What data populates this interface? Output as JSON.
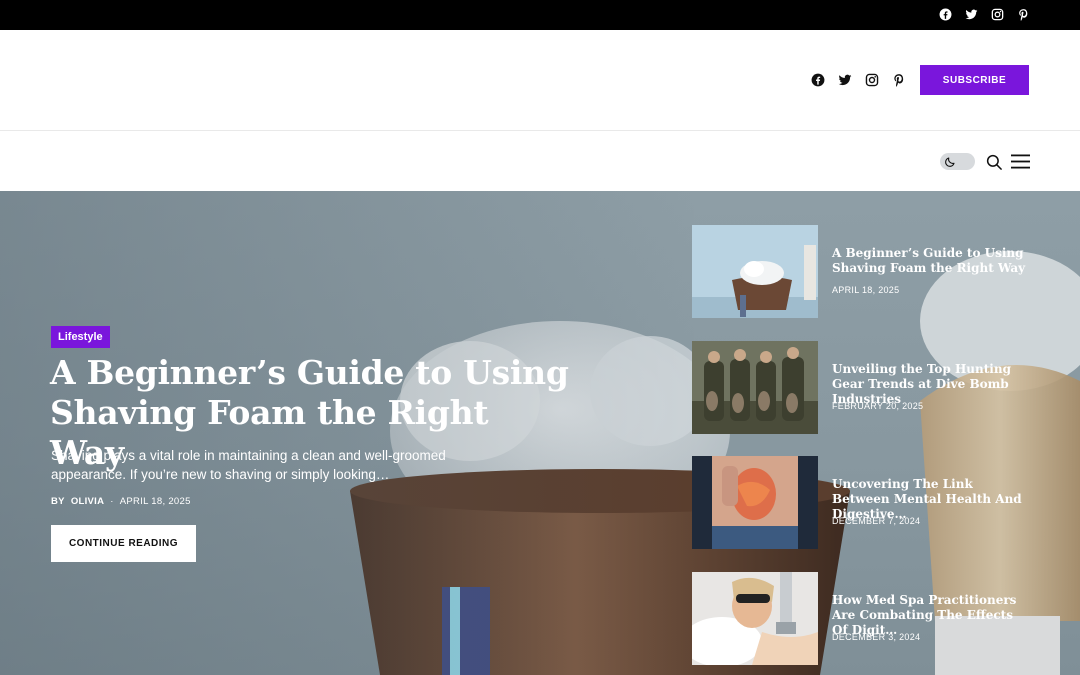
{
  "topbar": {
    "socials": [
      {
        "icon": "facebook-icon"
      },
      {
        "icon": "twitter-icon"
      },
      {
        "icon": "instagram-icon"
      },
      {
        "icon": "pinterest-icon"
      }
    ]
  },
  "header": {
    "socials": [
      {
        "icon": "facebook-icon"
      },
      {
        "icon": "twitter-icon"
      },
      {
        "icon": "instagram-icon"
      },
      {
        "icon": "pinterest-icon"
      }
    ],
    "subscribe_label": "SUBSCRIBE"
  },
  "navbar": {
    "toggle_icon": "moon-icon",
    "search_icon": "search-icon",
    "menu_icon": "hamburger-menu-icon"
  },
  "colors": {
    "accent": "#7a16dc",
    "topbar": "#000000"
  },
  "hero": {
    "category": "Lifestyle",
    "title": "A Beginner’s Guide to Using Shaving Foam the Right Way",
    "excerpt": "Shaving plays a vital role in maintaining a clean and well-groomed appearance. If you’re new to shaving or simply looking…",
    "by_label": "BY",
    "author": "OLIVIA",
    "separator": "·",
    "date": "APRIL 18, 2025",
    "button_label": "CONTINUE READING"
  },
  "side_posts": [
    {
      "title": "A Beginner’s Guide to Using Shaving Foam the Right Way",
      "date": "APRIL 18, 2025",
      "thumb": "shaving-bowl"
    },
    {
      "title": "Unveiling the Top Hunting Gear Trends at Dive Bomb Industries",
      "date": "FEBRUARY 20, 2025",
      "thumb": "hunters-group"
    },
    {
      "title": "Uncovering The Link Between Mental Health And Digestive…",
      "date": "DECEMBER 7, 2024",
      "thumb": "stomach-pain"
    },
    {
      "title": "How Med Spa Practitioners Are Combating The Effects Of Digit…",
      "date": "DECEMBER 3, 2024",
      "thumb": "laser-treatment"
    }
  ]
}
